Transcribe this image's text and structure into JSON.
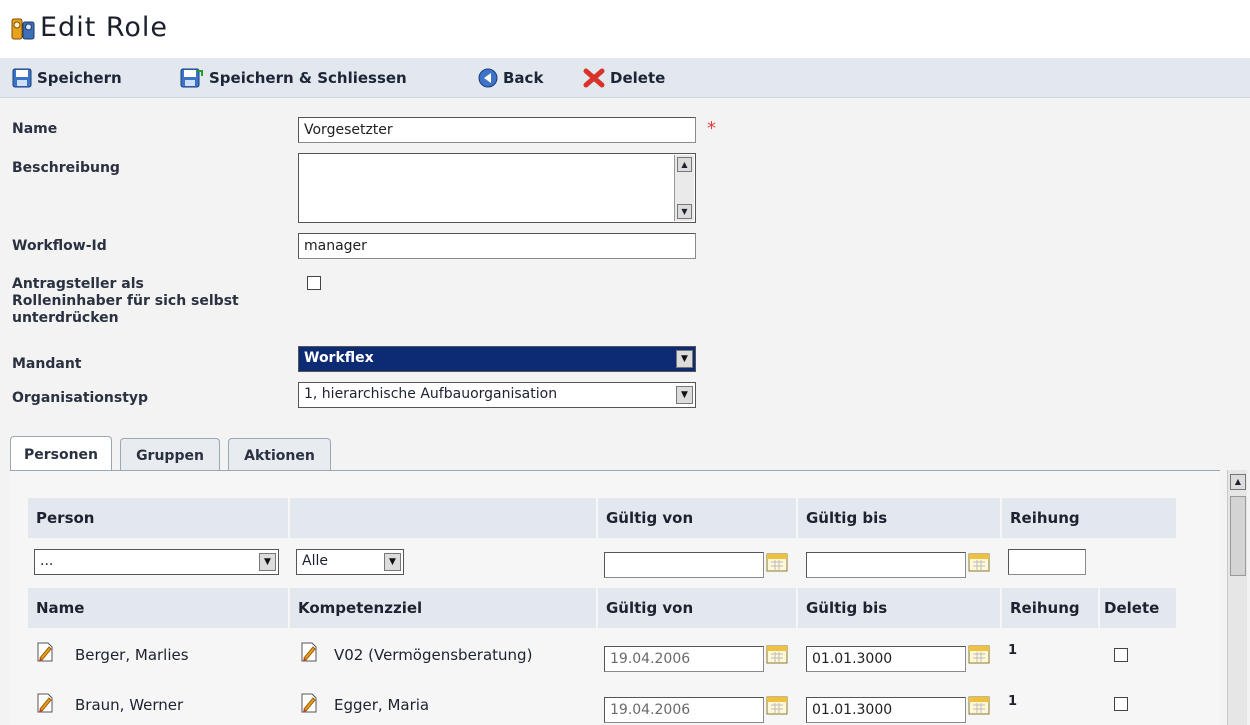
{
  "page": {
    "title": "Edit Role"
  },
  "toolbar": {
    "save_label": "Speichern",
    "save_close_label": "Speichern & Schliessen",
    "back_label": "Back",
    "delete_label": "Delete"
  },
  "form": {
    "name_label": "Name",
    "name_value": "Vorgesetzter",
    "required_mark": "*",
    "description_label": "Beschreibung",
    "description_value": "",
    "workflow_label": "Workflow-Id",
    "workflow_value": "manager",
    "suppress_label_1": "Antragsteller als",
    "suppress_label_2": "Rolleninhaber für sich selbst",
    "suppress_label_3": "unterdrücken",
    "suppress_checked": false,
    "mandant_label": "Mandant",
    "mandant_value": "Workflex",
    "orgtype_label": "Organisationstyp",
    "orgtype_value": "1, hierarchische Aufbauorganisation"
  },
  "tabs": [
    {
      "label": "Personen",
      "active": true
    },
    {
      "label": "Gruppen",
      "active": false
    },
    {
      "label": "Aktionen",
      "active": false
    }
  ],
  "filter": {
    "headers": {
      "person": "Person",
      "blank": "",
      "valid_from": "Gültig von",
      "valid_to": "Gültig bis",
      "order": "Reihung"
    },
    "person_select": "...",
    "scope_select": "Alle",
    "valid_from": "",
    "valid_to": "",
    "order": ""
  },
  "table": {
    "headers": {
      "name": "Name",
      "target": "Kompetenzziel",
      "valid_from": "Gültig von",
      "valid_to": "Gültig bis",
      "order": "Reihung",
      "delete": "Delete"
    },
    "rows": [
      {
        "name": "Berger, Marlies",
        "target": "V02 (Vermögensberatung)",
        "valid_from": "19.04.2006",
        "valid_to": "01.01.3000",
        "order": "1",
        "delete": false
      },
      {
        "name": "Braun, Werner",
        "target": "Egger, Maria",
        "valid_from": "19.04.2006",
        "valid_to": "01.01.3000",
        "order": "1",
        "delete": false
      }
    ]
  },
  "icons": {
    "title": "roles-icon",
    "save": "save-icon",
    "save_close": "save-close-icon",
    "back": "back-icon",
    "delete": "delete-x-icon",
    "calendar": "calendar-icon",
    "edit_doc": "edit-document-icon"
  },
  "colors": {
    "accent": "#0d2a74",
    "required": "#e04040",
    "delete_red": "#d8332a",
    "toolbar_bg": "#e3e8ee"
  }
}
